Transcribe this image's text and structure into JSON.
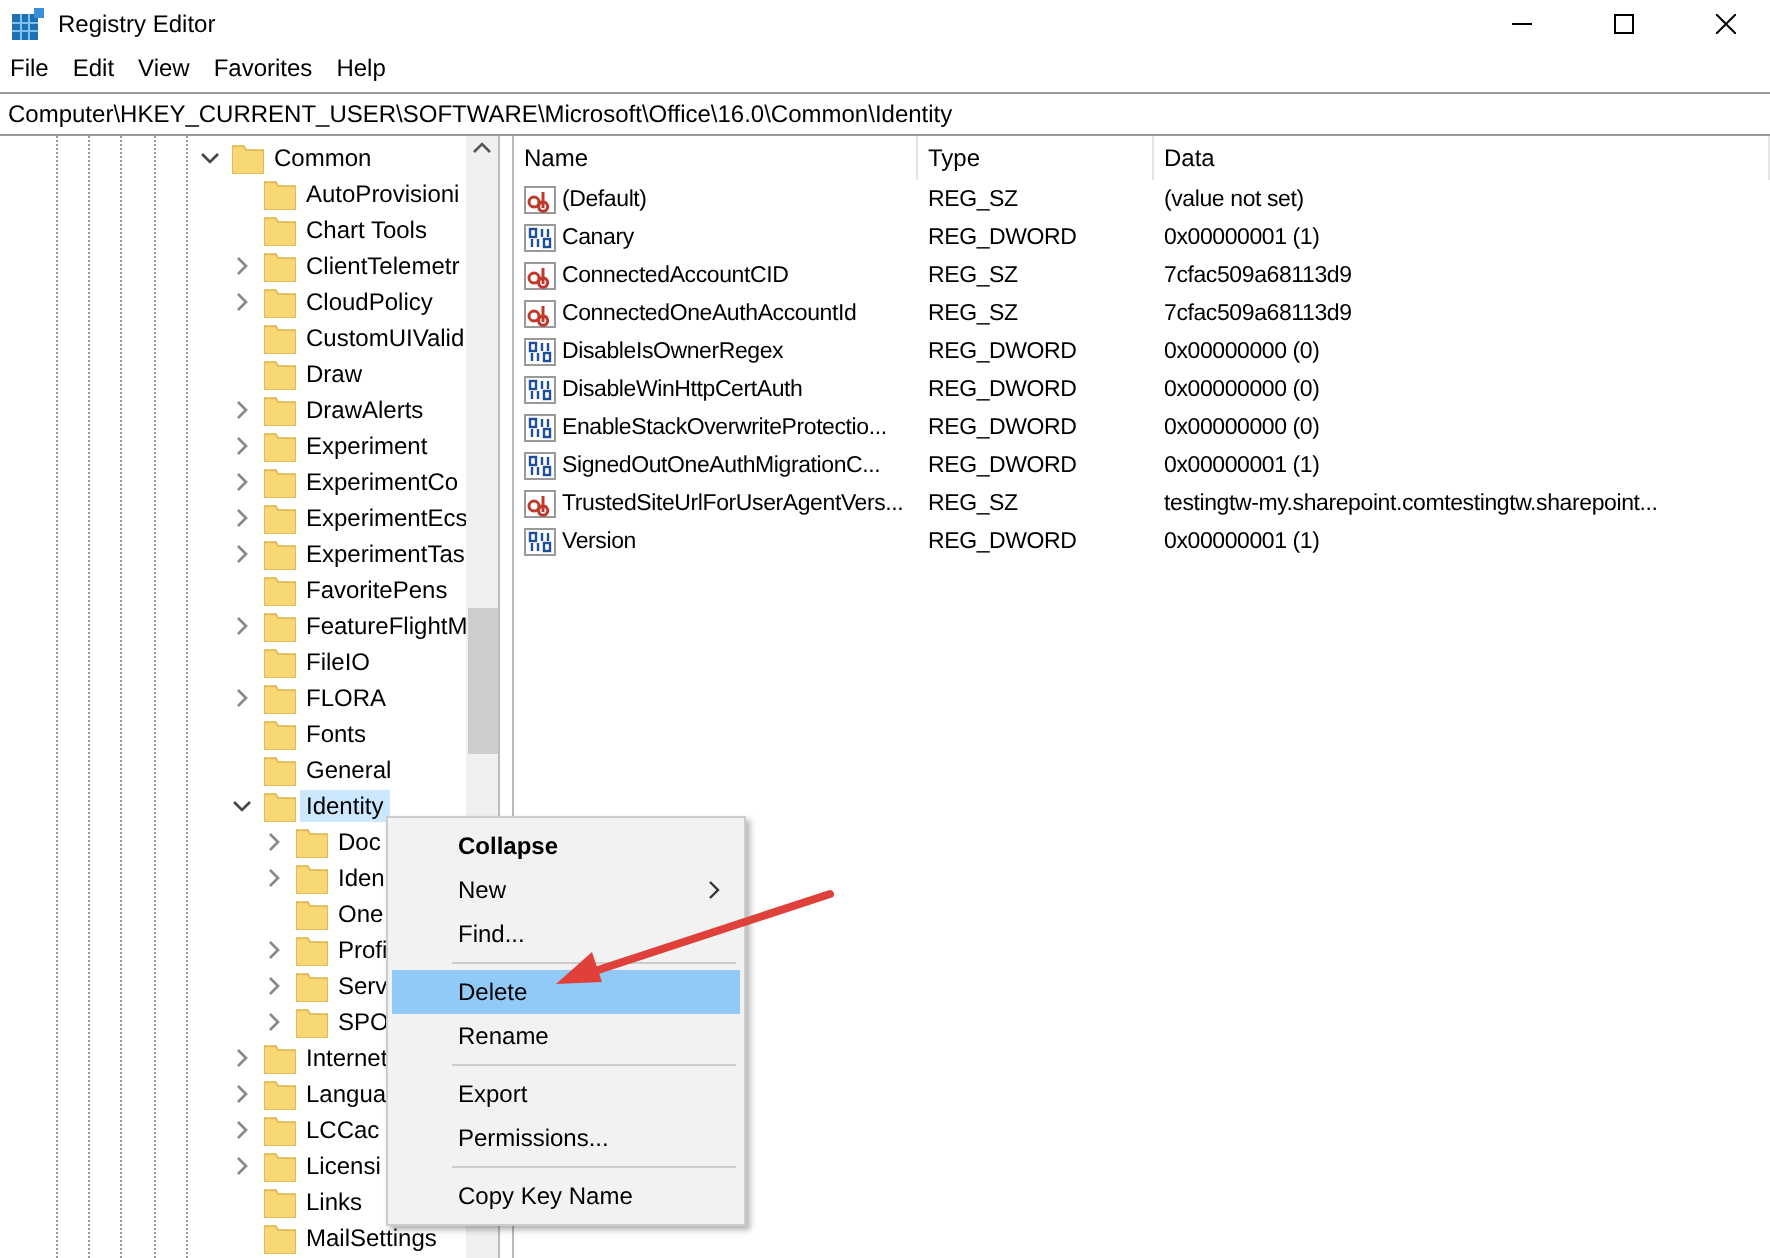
{
  "window": {
    "title": "Registry Editor"
  },
  "menu": [
    "File",
    "Edit",
    "View",
    "Favorites",
    "Help"
  ],
  "address": "Computer\\HKEY_CURRENT_USER\\SOFTWARE\\Microsoft\\Office\\16.0\\Common\\Identity",
  "tree": [
    {
      "label": "Common",
      "expandable": true,
      "expanded": true,
      "selected": false,
      "children": [
        {
          "label": "AutoProvisioni",
          "expandable": false,
          "selected": false
        },
        {
          "label": "Chart Tools",
          "expandable": false,
          "selected": false
        },
        {
          "label": "ClientTelemetr",
          "expandable": true,
          "expanded": false,
          "selected": false
        },
        {
          "label": "CloudPolicy",
          "expandable": true,
          "expanded": false,
          "selected": false
        },
        {
          "label": "CustomUIValid",
          "expandable": false,
          "selected": false
        },
        {
          "label": "Draw",
          "expandable": false,
          "selected": false
        },
        {
          "label": "DrawAlerts",
          "expandable": true,
          "expanded": false,
          "selected": false
        },
        {
          "label": "Experiment",
          "expandable": true,
          "expanded": false,
          "selected": false
        },
        {
          "label": "ExperimentCo",
          "expandable": true,
          "expanded": false,
          "selected": false
        },
        {
          "label": "ExperimentEcs",
          "expandable": true,
          "expanded": false,
          "selected": false
        },
        {
          "label": "ExperimentTas",
          "expandable": true,
          "expanded": false,
          "selected": false
        },
        {
          "label": "FavoritePens",
          "expandable": false,
          "selected": false
        },
        {
          "label": "FeatureFlightM",
          "expandable": true,
          "expanded": false,
          "selected": false
        },
        {
          "label": "FileIO",
          "expandable": false,
          "selected": false
        },
        {
          "label": "FLORA",
          "expandable": true,
          "expanded": false,
          "selected": false
        },
        {
          "label": "Fonts",
          "expandable": false,
          "selected": false
        },
        {
          "label": "General",
          "expandable": false,
          "selected": false
        },
        {
          "label": "Identity",
          "expandable": true,
          "expanded": true,
          "selected": true,
          "children": [
            {
              "label": "Doc",
              "expandable": true,
              "expanded": false,
              "selected": false
            },
            {
              "label": "Iden",
              "expandable": true,
              "expanded": false,
              "selected": false
            },
            {
              "label": "One",
              "expandable": false,
              "selected": false
            },
            {
              "label": "Profi",
              "expandable": true,
              "expanded": false,
              "selected": false
            },
            {
              "label": "Serv",
              "expandable": true,
              "expanded": false,
              "selected": false
            },
            {
              "label": "SPO",
              "expandable": true,
              "expanded": false,
              "selected": false
            }
          ]
        },
        {
          "label": "Internet",
          "expandable": true,
          "expanded": false,
          "selected": false
        },
        {
          "label": "Langua",
          "expandable": true,
          "expanded": false,
          "selected": false
        },
        {
          "label": "LCCac",
          "expandable": true,
          "expanded": false,
          "selected": false
        },
        {
          "label": "Licensi",
          "expandable": true,
          "expanded": false,
          "selected": false
        },
        {
          "label": "Links",
          "expandable": false,
          "selected": false
        },
        {
          "label": "MailSettings",
          "expandable": false,
          "selected": false
        }
      ]
    }
  ],
  "table": {
    "columns": [
      "Name",
      "Type",
      "Data"
    ],
    "rows": [
      {
        "kind": "string",
        "name": "(Default)",
        "type": "REG_SZ",
        "data": "(value not set)"
      },
      {
        "kind": "dword",
        "name": "Canary",
        "type": "REG_DWORD",
        "data": "0x00000001 (1)"
      },
      {
        "kind": "string",
        "name": "ConnectedAccountCID",
        "type": "REG_SZ",
        "data": "7cfac509a68113d9"
      },
      {
        "kind": "string",
        "name": "ConnectedOneAuthAccountId",
        "type": "REG_SZ",
        "data": "7cfac509a68113d9"
      },
      {
        "kind": "dword",
        "name": "DisableIsOwnerRegex",
        "type": "REG_DWORD",
        "data": "0x00000000 (0)"
      },
      {
        "kind": "dword",
        "name": "DisableWinHttpCertAuth",
        "type": "REG_DWORD",
        "data": "0x00000000 (0)"
      },
      {
        "kind": "dword",
        "name": "EnableStackOverwriteProtectio...",
        "type": "REG_DWORD",
        "data": "0x00000000 (0)"
      },
      {
        "kind": "dword",
        "name": "SignedOutOneAuthMigrationC...",
        "type": "REG_DWORD",
        "data": "0x00000001 (1)"
      },
      {
        "kind": "string",
        "name": "TrustedSiteUrlForUserAgentVers...",
        "type": "REG_SZ",
        "data": "testingtw-my.sharepoint.comtestingtw.sharepoint..."
      },
      {
        "kind": "dword",
        "name": "Version",
        "type": "REG_DWORD",
        "data": "0x00000001 (1)"
      }
    ]
  },
  "context_menu": [
    {
      "kind": "item",
      "label": "Collapse",
      "default": true,
      "submenu": false,
      "selected": false
    },
    {
      "kind": "item",
      "label": "New",
      "default": false,
      "submenu": true,
      "selected": false
    },
    {
      "kind": "item",
      "label": "Find...",
      "default": false,
      "submenu": false,
      "selected": false
    },
    {
      "kind": "separator"
    },
    {
      "kind": "item",
      "label": "Delete",
      "default": false,
      "submenu": false,
      "selected": true
    },
    {
      "kind": "item",
      "label": "Rename",
      "default": false,
      "submenu": false,
      "selected": false
    },
    {
      "kind": "separator"
    },
    {
      "kind": "item",
      "label": "Export",
      "default": false,
      "submenu": false,
      "selected": false
    },
    {
      "kind": "item",
      "label": "Permissions...",
      "default": false,
      "submenu": false,
      "selected": false
    },
    {
      "kind": "separator"
    },
    {
      "kind": "item",
      "label": "Copy Key Name",
      "default": false,
      "submenu": false,
      "selected": false
    }
  ]
}
